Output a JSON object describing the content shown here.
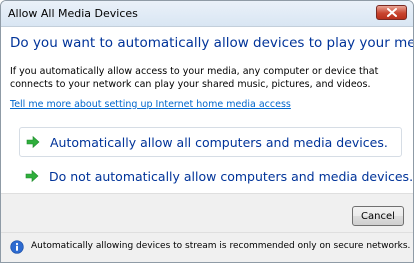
{
  "window": {
    "title": "Allow All Media Devices",
    "close_icon": "close-icon"
  },
  "dialog": {
    "main_instruction": "Do you want to automatically allow devices to play your media?",
    "body": "If you automatically allow access to your media, any computer or device that connects to your network can play your shared music, pictures, and videos.",
    "help_link": "Tell me more about setting up Internet home media access",
    "options": [
      {
        "label": "Automatically allow all computers and media devices.",
        "icon": "green-arrow-icon",
        "highlighted": true
      },
      {
        "label": "Do not automatically allow computers and media devices.",
        "icon": "green-arrow-icon",
        "highlighted": false
      }
    ],
    "cancel_label": "Cancel",
    "footer_note": "Automatically allowing devices to stream is recommended only on secure networks.",
    "footer_icon": "info-icon"
  },
  "colors": {
    "instruction": "#003399",
    "link": "#0066cc",
    "arrow": "#2fae3c",
    "info": "#2e6bd0"
  }
}
